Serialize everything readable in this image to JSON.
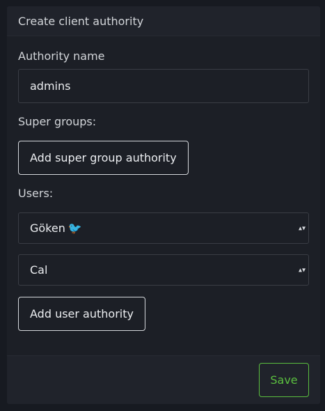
{
  "card": {
    "title": "Create client authority"
  },
  "form": {
    "authority_name_label": "Authority name",
    "authority_name_value": "admins",
    "super_groups_label": "Super groups:",
    "add_super_group_label": "Add super group authority",
    "users_label": "Users:",
    "users": [
      {
        "selected": "Göken",
        "emoji": "🐦"
      },
      {
        "selected": "Cal",
        "emoji": ""
      }
    ],
    "add_user_label": "Add user authority"
  },
  "footer": {
    "save_label": "Save"
  },
  "colors": {
    "page_bg": "#171a21",
    "card_bg": "#1c1f26",
    "header_bg": "#20232b",
    "save_accent": "#5bbf3f"
  },
  "icons": {
    "select_caret": "chevron-updown-icon"
  }
}
